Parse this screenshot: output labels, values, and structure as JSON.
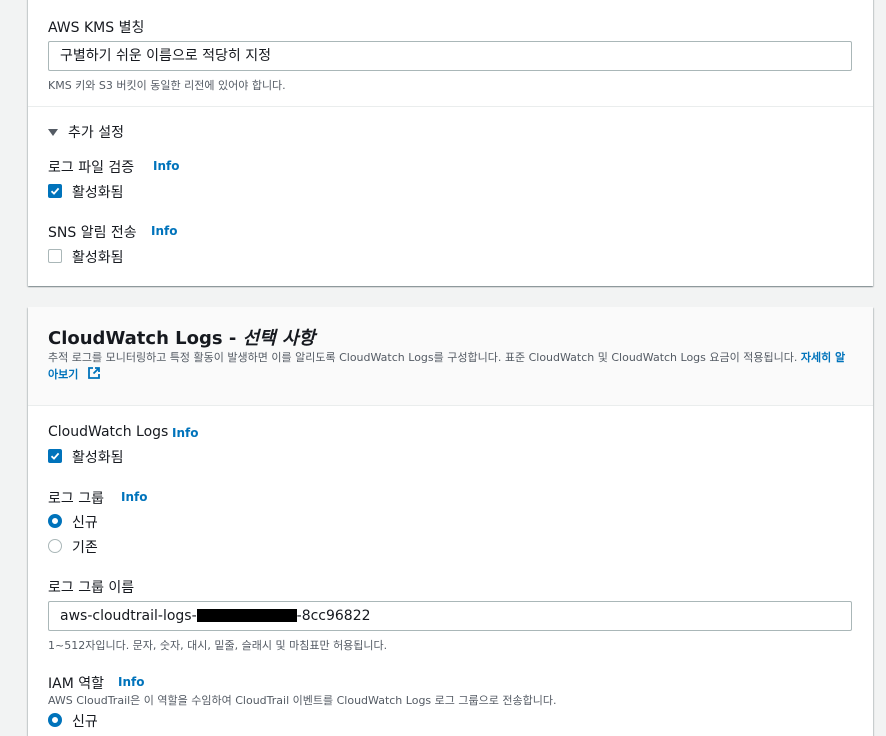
{
  "kms": {
    "alias_label": "AWS KMS 별칭",
    "alias_value": "구별하기 쉬운 이름으로 적당히 지정",
    "alias_hint": "KMS 키와 S3 버킷이 동일한 리전에 있어야 합니다."
  },
  "additional": {
    "toggle_label": "추가 설정",
    "log_validation_label": "로그 파일 검증",
    "log_validation_info": "Info",
    "log_validation_checkbox": "활성화됨",
    "log_validation_checked": true,
    "sns_label": "SNS 알림 전송",
    "sns_info": "Info",
    "sns_checkbox": "활성화됨",
    "sns_checked": false
  },
  "cloudwatch": {
    "title": "CloudWatch Logs - ",
    "title_optional": "선택 사항",
    "description": "추적 로그를 모니터링하고 특정 활동이 발생하면 이를 알리도록 CloudWatch Logs를 구성합니다. 표준 CloudWatch 및 CloudWatch Logs 요금이 적용됩니다. ",
    "learn_more": "자세히 알아보기",
    "enable_label": "CloudWatch Logs",
    "enable_info": "Info",
    "enable_checkbox": "활성화됨",
    "enable_checked": true,
    "log_group_label": "로그 그룹",
    "log_group_info": "Info",
    "log_group_new": "신규",
    "log_group_existing": "기존",
    "log_group_name_label": "로그 그룹 이름",
    "log_group_name_prefix": "aws-cloudtrail-logs-",
    "log_group_name_suffix": "-8cc96822",
    "log_group_name_hint": "1~512자입니다. 문자, 숫자, 대시, 밑줄, 슬래시 및 마침표만 허용됩니다.",
    "iam_label": "IAM 역할",
    "iam_info": "Info",
    "iam_description": "AWS CloudTrail은 이 역할을 수임하여 CloudTrail 이벤트를 CloudWatch Logs 로그 그룹으로 전송합니다.",
    "iam_new": "신규"
  },
  "colors": {
    "accent": "#0073bb",
    "text": "#16191f",
    "muted": "#545b64",
    "background": "#f2f3f3"
  }
}
